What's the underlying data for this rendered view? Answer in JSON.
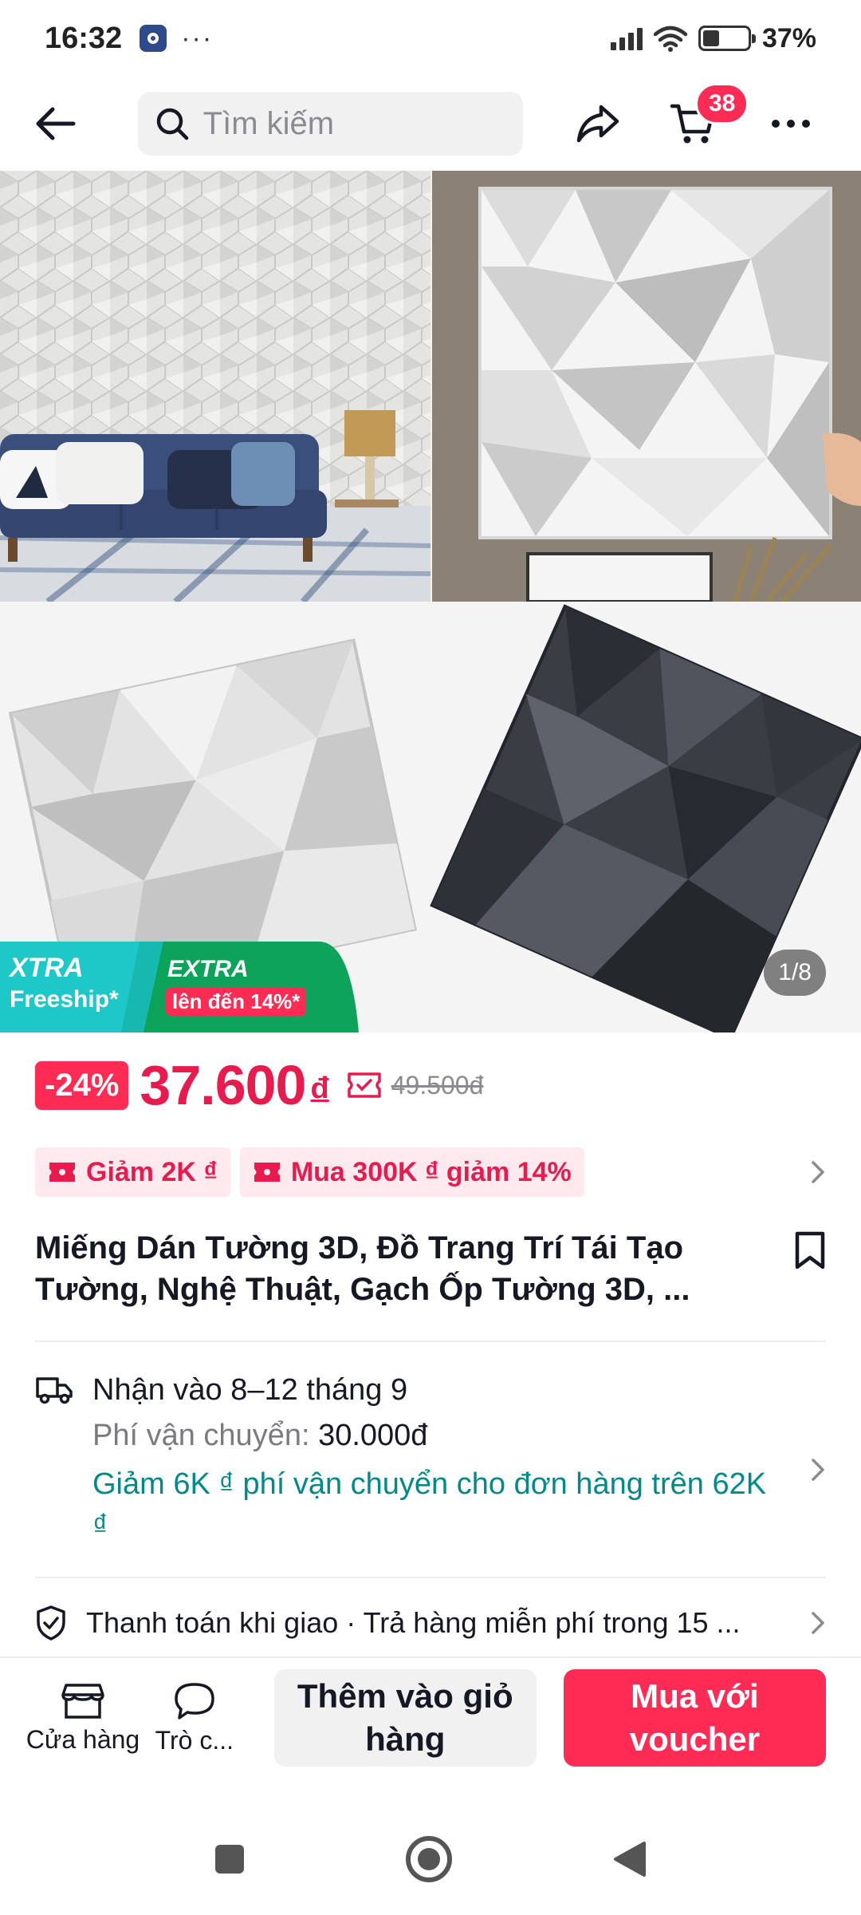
{
  "status_bar": {
    "time": "16:32",
    "dots": "···",
    "battery": "37%",
    "battery_level": 0.37
  },
  "header": {
    "search_placeholder": "Tìm kiếm",
    "cart_count": "38"
  },
  "gallery": {
    "page_indicator": "1/8",
    "promo_left_line1": "XTRA",
    "promo_left_line2": "Freeship*",
    "promo_right_line1": "EXTRA",
    "promo_right_line2": "lên đến 14%*"
  },
  "price": {
    "discount": "-24%",
    "current": "37.600",
    "currency": "đ",
    "original": "49.500đ"
  },
  "coupons": [
    {
      "label": "Giảm 2K ₫"
    },
    {
      "label": "Mua 300K ₫ giảm 14%"
    }
  ],
  "product": {
    "title": "Miếng Dán Tường 3D, Đồ Trang Trí Tái Tạo Tường, Nghệ Thuật, Gạch Ốp Tường 3D, ..."
  },
  "shipping": {
    "delivery": "Nhận vào 8–12 tháng 9",
    "fee_label": "Phí vận chuyển: ",
    "fee_value": "30.000đ",
    "promo": "Giảm 6K ₫ phí vận chuyển cho đơn hàng trên 62K ₫"
  },
  "payment": {
    "text": "Thanh toán khi giao · Trả hàng miễn phí trong 15 ..."
  },
  "bottom_bar": {
    "shop_label": "Cửa hàng",
    "chat_label": "Trò c...",
    "add_to_cart": "Thêm vào giỏ hàng",
    "buy_voucher": "Mua với voucher"
  }
}
